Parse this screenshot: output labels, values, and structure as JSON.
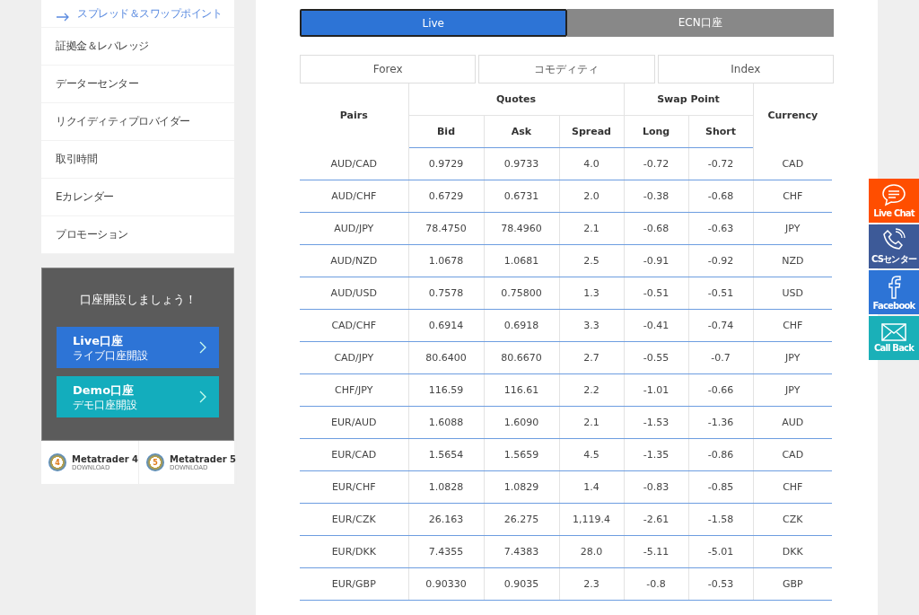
{
  "sidebar": {
    "items": [
      {
        "label": "スプレッド＆スワップポイント",
        "selected": true
      },
      {
        "label": "証拠金＆レバレッジ",
        "selected": false
      },
      {
        "label": "データーセンター",
        "selected": false
      },
      {
        "label": "リクイディティプロバイダー",
        "selected": false
      },
      {
        "label": "取引時間",
        "selected": false
      },
      {
        "label": "Eカレンダー",
        "selected": false
      },
      {
        "label": "プロモーション",
        "selected": false
      }
    ]
  },
  "promo": {
    "title": "口座開設しましょう！",
    "buttons": [
      {
        "title": "Live口座",
        "subtitle": "ライブ口座開設",
        "color": "#2d74d6"
      },
      {
        "title": "Demo口座",
        "subtitle": "デモ口座開設",
        "color": "#13adbd"
      }
    ]
  },
  "downloads": [
    {
      "name": "Metatrader 4",
      "badge": "4",
      "caption": "DOWNLOAD"
    },
    {
      "name": "Metatrader 5",
      "badge": "5",
      "caption": "DOWNLOAD"
    }
  ],
  "account_tabs": [
    {
      "label": "Live",
      "selected": true
    },
    {
      "label": "ECN口座",
      "selected": false
    }
  ],
  "category_tabs": [
    {
      "label": "Forex",
      "selected": false
    },
    {
      "label": "コモディティ",
      "selected": false
    },
    {
      "label": "Index",
      "selected": false
    }
  ],
  "table": {
    "column_groups": [
      {
        "label": "Quotes"
      },
      {
        "label": "Swap Point"
      }
    ],
    "columns": [
      "Pairs",
      "Bid",
      "Ask",
      "Spread",
      "Long",
      "Short",
      "Currency"
    ],
    "rows": [
      [
        "AUD/CAD",
        "0.9729",
        "0.9733",
        "4.0",
        "-0.72",
        "-0.72",
        "CAD"
      ],
      [
        "AUD/CHF",
        "0.6729",
        "0.6731",
        "2.0",
        "-0.38",
        "-0.68",
        "CHF"
      ],
      [
        "AUD/JPY",
        "78.4750",
        "78.4960",
        "2.1",
        "-0.68",
        "-0.63",
        "JPY"
      ],
      [
        "AUD/NZD",
        "1.0678",
        "1.0681",
        "2.5",
        "-0.91",
        "-0.92",
        "NZD"
      ],
      [
        "AUD/USD",
        "0.7578",
        "0.75800",
        "1.3",
        "-0.51",
        "-0.51",
        "USD"
      ],
      [
        "CAD/CHF",
        "0.6914",
        "0.6918",
        "3.3",
        "-0.41",
        "-0.74",
        "CHF"
      ],
      [
        "CAD/JPY",
        "80.6400",
        "80.6670",
        "2.7",
        "-0.55",
        "-0.7",
        "JPY"
      ],
      [
        "CHF/JPY",
        "116.59",
        "116.61",
        "2.2",
        "-1.01",
        "-0.66",
        "JPY"
      ],
      [
        "EUR/AUD",
        "1.6088",
        "1.6090",
        "2.1",
        "-1.53",
        "-1.36",
        "AUD"
      ],
      [
        "EUR/CAD",
        "1.5654",
        "1.5659",
        "4.5",
        "-1.35",
        "-0.86",
        "CAD"
      ],
      [
        "EUR/CHF",
        "1.0828",
        "1.0829",
        "1.4",
        "-0.83",
        "-0.85",
        "CHF"
      ],
      [
        "EUR/CZK",
        "26.163",
        "26.275",
        "1,119.4",
        "-2.61",
        "-1.58",
        "CZK"
      ],
      [
        "EUR/DKK",
        "7.4355",
        "7.4383",
        "28.0",
        "-5.11",
        "-5.01",
        "DKK"
      ],
      [
        "EUR/GBP",
        "0.90330",
        "0.9035",
        "2.3",
        "-0.8",
        "-0.53",
        "GBP"
      ]
    ]
  },
  "float_buttons": [
    {
      "kind": "chat",
      "label": "Live Chat",
      "color": "#ff4e00"
    },
    {
      "kind": "phone",
      "label": "CSセンター",
      "color": "#3d5a98"
    },
    {
      "kind": "facebook",
      "label": "Facebook",
      "color": "#2d74d6"
    },
    {
      "kind": "mail",
      "label": "Call Back",
      "color": "#1ab0b8"
    }
  ]
}
